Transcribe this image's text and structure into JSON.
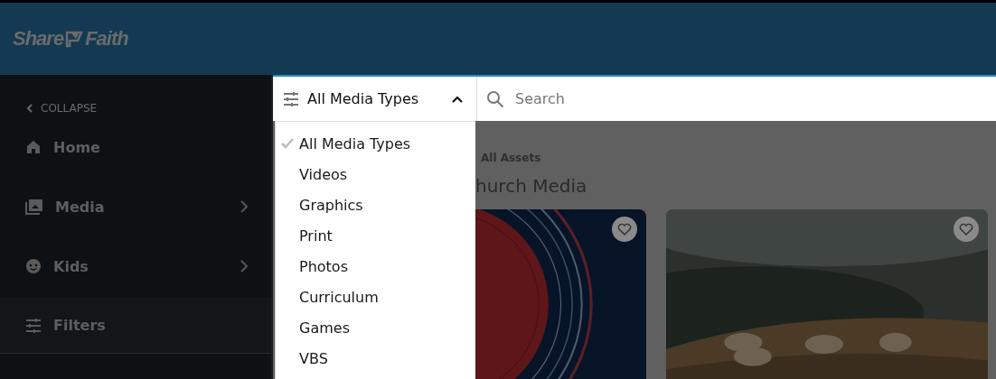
{
  "header": {
    "logo": [
      "Share",
      "Faith"
    ]
  },
  "sidebar": {
    "collapse": "COLLAPSE",
    "items": [
      {
        "label": "Home",
        "submenu": false,
        "active": false
      },
      {
        "label": "Media",
        "submenu": true,
        "active": false
      },
      {
        "label": "Kids",
        "submenu": true,
        "active": false
      },
      {
        "label": "Filters",
        "submenu": false,
        "active": true
      }
    ]
  },
  "filter": {
    "label": "All Media Types",
    "expanded": true,
    "options": [
      {
        "label": "All Media Types",
        "selected": true
      },
      {
        "label": "Videos",
        "selected": false
      },
      {
        "label": "Graphics",
        "selected": false
      },
      {
        "label": "Print",
        "selected": false
      },
      {
        "label": "Photos",
        "selected": false
      },
      {
        "label": "Curriculum",
        "selected": false
      },
      {
        "label": "Games",
        "selected": false
      },
      {
        "label": "VBS",
        "selected": false
      }
    ]
  },
  "search": {
    "placeholder": "Search"
  },
  "content": {
    "breadcrumb": "All Assets",
    "heading": "hurch Media"
  }
}
